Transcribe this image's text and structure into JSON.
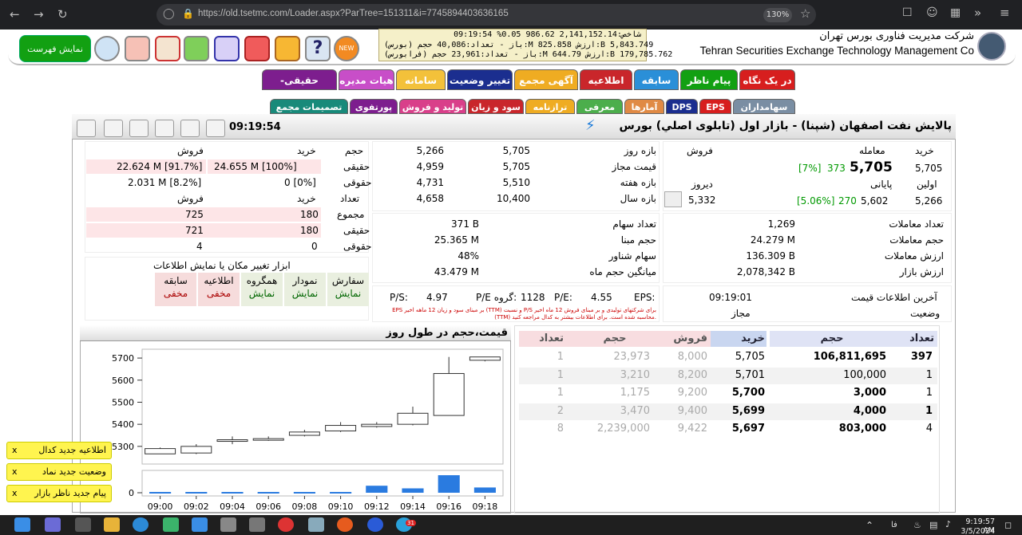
{
  "browser": {
    "url": "https://old.tsetmc.com/Loader.aspx?ParTree=151311&i=7745894403636165",
    "zoom": "130%"
  },
  "header": {
    "show_list_label": "نمایش فهرست",
    "new_badge": "NEW",
    "ticker": [
      "شاخص:2,141,152.14 986.62 0.05% 09:19:54",
      "(بورس) باز - تعداد:40,086 حجم:M 825.858 ارزش:B 5,843.749",
      "(فرابورس) باز - تعداد:23,961 حجم:M 644.79 ارزش:B 179,785.762"
    ],
    "company_fa": "شرکت مدیریت فناوری بورس تهران",
    "company_en": "Tehran Securities Exchange Technology Management Co"
  },
  "tabs_row1": [
    {
      "label": "در یک نگاه",
      "color": "#d71e1e"
    },
    {
      "label": "پیام ناظر",
      "color": "#12a012"
    },
    {
      "label": "سابقه",
      "color": "#2a8fd8"
    },
    {
      "label": "اطلاعیه",
      "color": "#c9262b"
    },
    {
      "label": "آگهی مجمع",
      "color": "#efac22"
    },
    {
      "label": "تغییر وضعیت",
      "color": "#1b2e8f"
    },
    {
      "label": "سامانه",
      "color": "#f3c13a"
    },
    {
      "label": "هیات مدیره",
      "color": "#c84ec8"
    },
    {
      "label": "حقیقی-حقوقی",
      "color": "#7d1e8e"
    }
  ],
  "tabs_row2": [
    {
      "label": "سهامداران",
      "color": "#7a8ea3"
    },
    {
      "label": "EPS",
      "color": "#d71e1e"
    },
    {
      "label": "DPS",
      "color": "#1b2e8f"
    },
    {
      "label": "آمارها",
      "color": "#e08a45"
    },
    {
      "label": "معرفی",
      "color": "#4cae4c"
    },
    {
      "label": "ترازنامه",
      "color": "#efac22"
    },
    {
      "label": "سود و زیان",
      "color": "#c9262b"
    },
    {
      "label": "تولید و فروش",
      "color": "#d93f8a"
    },
    {
      "label": "پورتفوی",
      "color": "#7d1e8e"
    },
    {
      "label": "تصمیمات مجمع",
      "color": "#188a7a"
    }
  ],
  "panel": {
    "time": "09:19:54",
    "title": "پالايش نفت اصفهان (شپنا) - بازار اول (تابلوی اصلي) بورس"
  },
  "price_block": {
    "buy_h": "خرید",
    "trade_h": "معامله",
    "sell_h": "فروش",
    "buy": "5,705",
    "trade_val": "5,705",
    "trade_chg": "373",
    "trade_pct": "[7%]",
    "first_label": "اولین",
    "first": "5,266",
    "final_label": "پایانی",
    "final": "5,602",
    "final_chg": "270",
    "final_pct": "[5.06%]",
    "yesterday_label": "دیروز",
    "yesterday": "5,332"
  },
  "range_block": [
    {
      "label": "بازه روز",
      "a": "5,705",
      "b": "5,266"
    },
    {
      "label": "قیمت مجاز",
      "a": "5,705",
      "b": "4,959"
    },
    {
      "label": "بازه هفته",
      "a": "5,510",
      "b": "4,731"
    },
    {
      "label": "بازه سال",
      "a": "10,400",
      "b": "4,658"
    }
  ],
  "client_block": {
    "h_buy": "خرید",
    "h_sell": "فروش",
    "h_vol": "حجم",
    "h_count": "تعداد",
    "real_label": "حقیقی",
    "legal_label": "حقوقی",
    "total_label": "مجموع",
    "real_buy_vol": "24.655 M [100%]",
    "real_sell_vol": "22.624 M [91.7%]",
    "legal_buy_vol": "0 [0%]",
    "legal_sell_vol": "2.031 M [8.2%]",
    "total_buy": "180",
    "total_sell": "725",
    "real_buy": "180",
    "real_sell": "721",
    "legal_buy": "0",
    "legal_sell": "4"
  },
  "stats_mid": [
    {
      "label": "تعداد سهام",
      "value": "371 B"
    },
    {
      "label": "حجم مبنا",
      "value": "25.365 M"
    },
    {
      "label": "سهام شناور",
      "value": "48%"
    },
    {
      "label": "میانگین حجم ماه",
      "value": "43.479 M"
    }
  ],
  "stats_right": [
    {
      "label": "تعداد معاملات",
      "value": "1,269"
    },
    {
      "label": "حجم معاملات",
      "value": "24.279 M"
    },
    {
      "label": "ارزش معاملات",
      "value": "136.309 B"
    },
    {
      "label": "ارزش بازار",
      "value": "2,078,342 B"
    }
  ],
  "tools": {
    "title": "ابزار تغییر مکان یا نمایش اطلاعات",
    "items": [
      {
        "name": "سفارش",
        "state": "نمایش"
      },
      {
        "name": "نمودار",
        "state": "نمایش"
      },
      {
        "name": "همگروه",
        "state": "نمایش"
      },
      {
        "name": "اطلاعیه",
        "state": "مخفی"
      },
      {
        "name": "سابقه",
        "state": "مخفی"
      }
    ]
  },
  "ratios": {
    "eps_label": "EPS:",
    "eps": "4.55",
    "pe_label": "P/E:",
    "pe": "1128",
    "gpe_label": "P/E گروه:",
    "gpe": "4.97",
    "ps_label": "P/S:",
    "ps": "",
    "note": "EPS بر مبنای سود و زیان 12 ماهه اخیر (TTM) و نسبت P/S برای شرکتهای تولیدی و بر مبنای فروش 12 ماه اخیر (TTM) محاسبه شده است. برای اطلاعات بیشتر به کدال مراجعه کنید."
  },
  "last_info": {
    "label": "آخرین اطلاعات قیمت",
    "value": "09:19:01",
    "status_label": "وضعیت",
    "status": "مجاز"
  },
  "chart": {
    "title": "قیمت،حجم در طول روز"
  },
  "chart_data": {
    "type": "candlestick",
    "x": [
      "09:00",
      "09:02",
      "09:04",
      "09:06",
      "09:08",
      "09:10",
      "09:12",
      "09:14",
      "09:16",
      "09:18"
    ],
    "open": [
      5266,
      5270,
      5325,
      5330,
      5350,
      5370,
      5390,
      5400,
      5440,
      5690
    ],
    "close": [
      5290,
      5300,
      5330,
      5335,
      5365,
      5395,
      5400,
      5450,
      5630,
      5705
    ],
    "high": [
      5295,
      5310,
      5345,
      5345,
      5375,
      5410,
      5410,
      5480,
      5705,
      5705
    ],
    "low": [
      5266,
      5265,
      5310,
      5325,
      5345,
      5365,
      5385,
      5395,
      5440,
      5685
    ],
    "volume": [
      0,
      0,
      0,
      0,
      0,
      0,
      0.4,
      0.25,
      1,
      0.3
    ],
    "yticks": [
      5300,
      5400,
      5500,
      5600,
      5700
    ],
    "ylim": [
      5220,
      5740
    ],
    "volume_tick": "0"
  },
  "orderbook": {
    "headers": {
      "count": "تعداد",
      "volume": "حجم",
      "buy": "خرید",
      "sell": "فروش"
    },
    "rows": [
      {
        "bc": "397",
        "bv": "106,811,695",
        "bp": "5,705",
        "sp": "8,000",
        "sv": "23,973",
        "sc": "1"
      },
      {
        "bc": "1",
        "bv": "100,000",
        "bp": "5,701",
        "sp": "8,200",
        "sv": "3,210",
        "sc": "1"
      },
      {
        "bc": "1",
        "bv": "3,000",
        "bp": "5,700",
        "sp": "9,200",
        "sv": "1,175",
        "sc": "1"
      },
      {
        "bc": "1",
        "bv": "4,000",
        "bp": "5,699",
        "sp": "9,400",
        "sv": "3,470",
        "sc": "2"
      },
      {
        "bc": "4",
        "bv": "803,000",
        "bp": "5,697",
        "sp": "9,422",
        "sv": "2,239,000",
        "sc": "8"
      }
    ]
  },
  "toasts": [
    {
      "label": "اطلاعیه جدید کدال",
      "close": "x"
    },
    {
      "label": "وضعیت جدید نماد",
      "close": "x"
    },
    {
      "label": "پیام جدید ناظر بازار",
      "close": "x"
    }
  ],
  "taskbar": {
    "time": "9:19:57 AM",
    "date": "3/5/2024",
    "lang": "فا",
    "badge": "31"
  }
}
